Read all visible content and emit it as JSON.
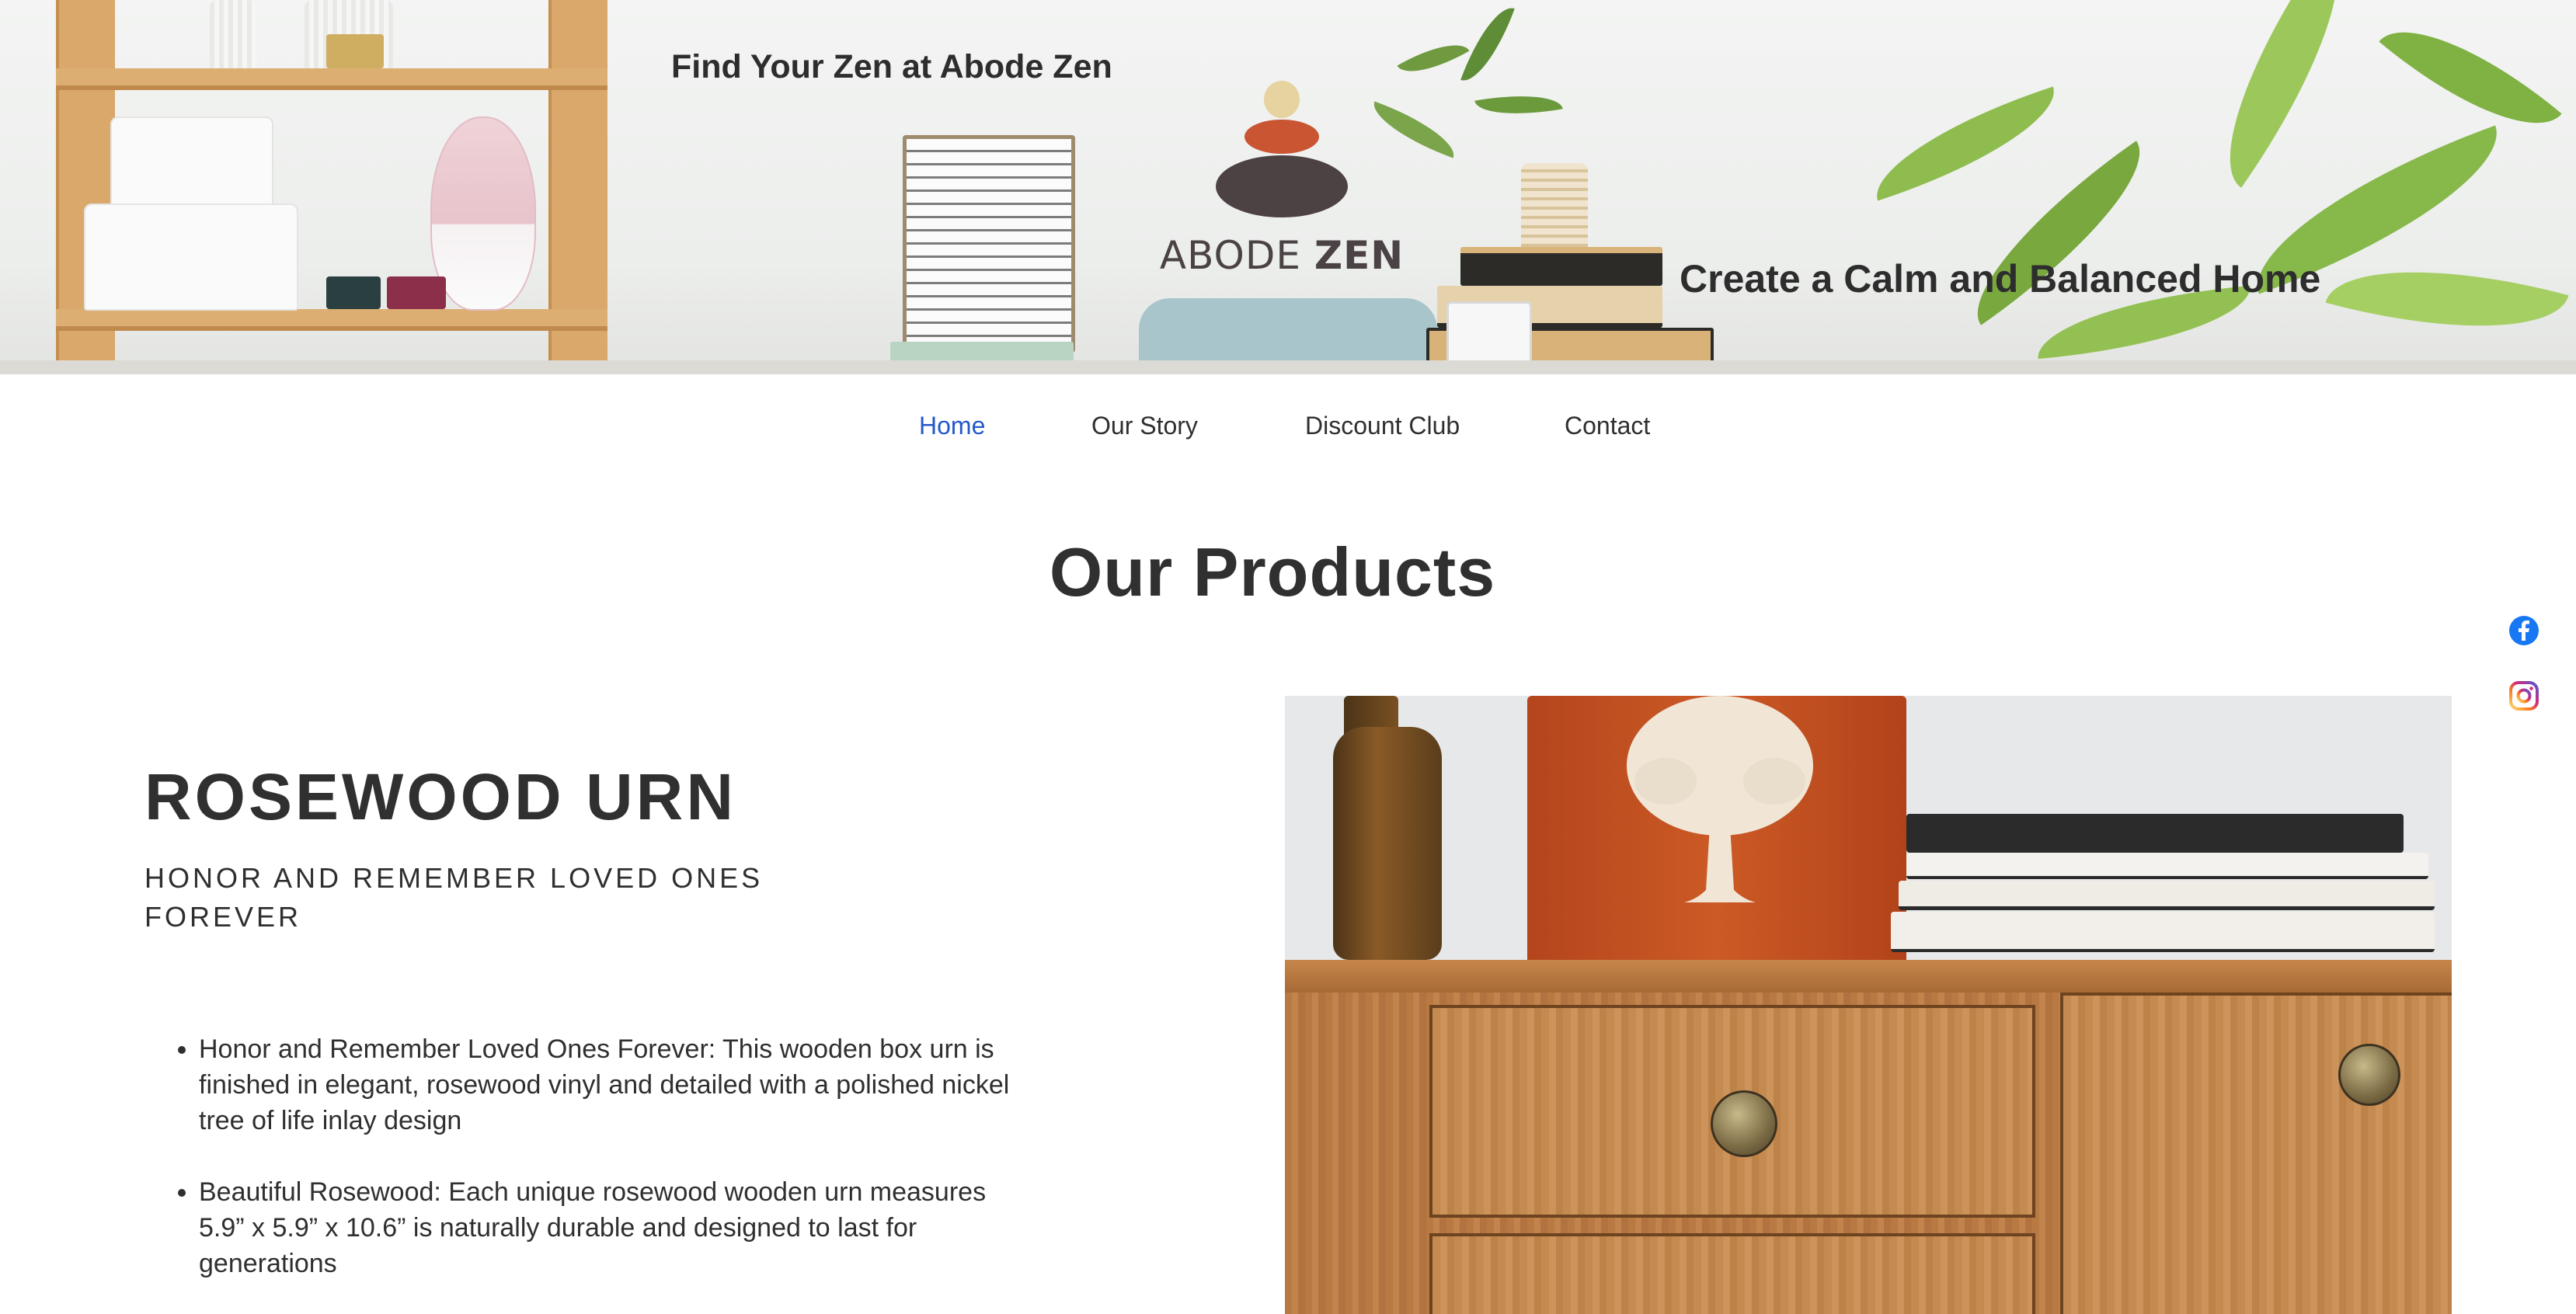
{
  "hero": {
    "tagline_top": "Find Your Zen at Abode Zen",
    "tagline_bottom": "Create a Calm and Balanced Home",
    "logo_text_light": "ABODE ",
    "logo_text_bold": "ZEN"
  },
  "nav": {
    "items": [
      {
        "label": "Home",
        "active": true
      },
      {
        "label": "Our Story",
        "active": false
      },
      {
        "label": "Discount Club",
        "active": false
      },
      {
        "label": "Contact",
        "active": false
      }
    ],
    "active_color": "#2458c9"
  },
  "page": {
    "section_title": "Our Products"
  },
  "social": {
    "icons": [
      "facebook-icon",
      "instagram-icon"
    ]
  },
  "product": {
    "name": "ROSEWOOD URN",
    "subtitle": "HONOR AND REMEMBER LOVED ONES FOREVER",
    "features": [
      "Honor and Remember Loved Ones Forever: This wooden box urn is finished in elegant, rosewood vinyl and detailed with a polished nickel tree of life inlay design",
      "Beautiful Rosewood: Each unique rosewood wooden urn measures 5.9” x 5.9” x 10.6” is naturally durable and designed to last for generations"
    ]
  },
  "colors": {
    "text": "#2f2f2f",
    "facebook": "#1877f2",
    "instagram": "#d6249f"
  }
}
